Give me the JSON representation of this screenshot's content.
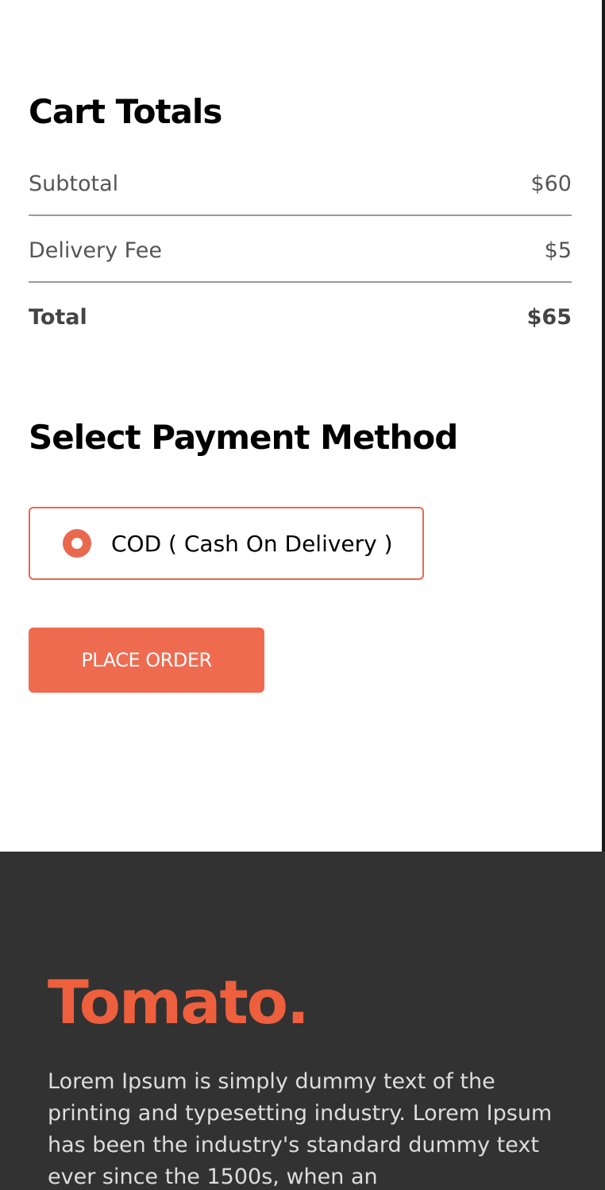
{
  "cart_totals": {
    "title": "Cart Totals",
    "subtotal_label": "Subtotal",
    "subtotal_value": "$60",
    "delivery_label": "Delivery Fee",
    "delivery_value": "$5",
    "total_label": "Total",
    "total_value": "$65"
  },
  "payment": {
    "title": "Select Payment Method",
    "option_label": "COD ( Cash On Delivery )",
    "selected": true
  },
  "actions": {
    "place_order_label": "PLACE ORDER"
  },
  "footer": {
    "logo": "Tomato.",
    "description": "Lorem Ipsum is simply dummy text of the printing and typesetting industry. Lorem Ipsum has been the industry's standard dummy text ever since the 1500s, when an"
  },
  "colors": {
    "accent": "#ef6b50",
    "footer_bg": "#323232",
    "logo": "#ee5f3e"
  }
}
